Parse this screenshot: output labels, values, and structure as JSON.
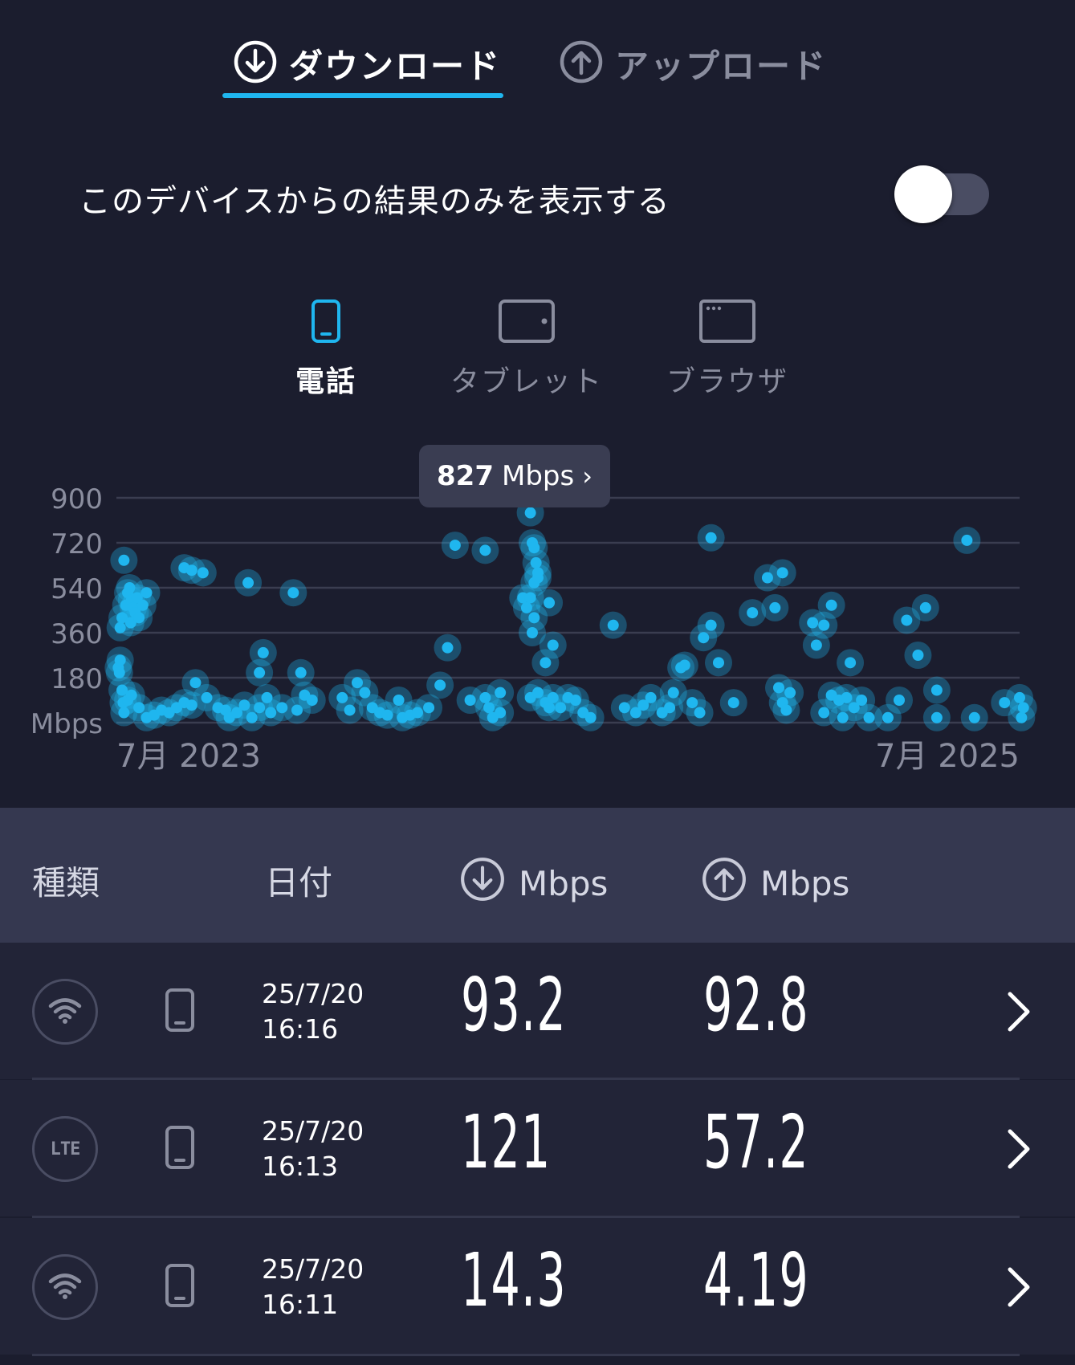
{
  "tabs": {
    "download_label": "ダウンロード",
    "upload_label": "アップロード"
  },
  "filter": {
    "toggle_label": "このデバイスからの結果のみを表示する",
    "toggle_on": false
  },
  "device_tabs": [
    {
      "label": "電話",
      "icon": "phone-icon",
      "active": true
    },
    {
      "label": "タブレット",
      "icon": "tablet-icon",
      "active": false
    },
    {
      "label": "ブラウザ",
      "icon": "browser-icon",
      "active": false
    }
  ],
  "tooltip": {
    "value": "827",
    "unit": "Mbps",
    "chevron": "›"
  },
  "chart_data": {
    "type": "scatter",
    "ylabel": "Mbps",
    "yticks": [
      "900",
      "720",
      "540",
      "360",
      "180"
    ],
    "ylim": [
      0,
      900
    ],
    "xlim": [
      0,
      24
    ],
    "xtick_labels": [
      "7月 2023",
      "7月 2025"
    ],
    "xtick_values": [
      0,
      24
    ],
    "marker_color": "#1fb6ef",
    "grid": true,
    "points": [
      [
        0.05,
        220
      ],
      [
        0.08,
        200
      ],
      [
        0.1,
        250
      ],
      [
        0.15,
        130
      ],
      [
        0.18,
        80
      ],
      [
        0.2,
        40
      ],
      [
        0.1,
        380
      ],
      [
        0.15,
        420
      ],
      [
        0.2,
        650
      ],
      [
        0.25,
        470
      ],
      [
        0.3,
        520
      ],
      [
        0.35,
        540
      ],
      [
        0.38,
        400
      ],
      [
        0.4,
        490
      ],
      [
        0.45,
        460
      ],
      [
        0.5,
        440
      ],
      [
        0.55,
        500
      ],
      [
        0.6,
        420
      ],
      [
        0.7,
        470
      ],
      [
        0.8,
        520
      ],
      [
        0.3,
        90
      ],
      [
        0.4,
        110
      ],
      [
        0.6,
        60
      ],
      [
        0.8,
        20
      ],
      [
        1.0,
        30
      ],
      [
        1.2,
        50
      ],
      [
        1.4,
        40
      ],
      [
        1.6,
        60
      ],
      [
        1.8,
        80
      ],
      [
        2.0,
        70
      ],
      [
        1.8,
        620
      ],
      [
        2.0,
        610
      ],
      [
        2.3,
        600
      ],
      [
        2.1,
        160
      ],
      [
        2.4,
        100
      ],
      [
        2.7,
        60
      ],
      [
        2.9,
        50
      ],
      [
        3.0,
        20
      ],
      [
        3.2,
        40
      ],
      [
        3.4,
        70
      ],
      [
        3.6,
        20
      ],
      [
        3.8,
        60
      ],
      [
        3.5,
        560
      ],
      [
        3.9,
        280
      ],
      [
        3.8,
        200
      ],
      [
        4.0,
        100
      ],
      [
        4.1,
        40
      ],
      [
        4.4,
        60
      ],
      [
        4.8,
        50
      ],
      [
        4.7,
        520
      ],
      [
        4.9,
        200
      ],
      [
        5.0,
        110
      ],
      [
        5.2,
        90
      ],
      [
        6.0,
        100
      ],
      [
        6.2,
        50
      ],
      [
        6.4,
        160
      ],
      [
        6.6,
        120
      ],
      [
        6.8,
        60
      ],
      [
        7.0,
        40
      ],
      [
        7.2,
        30
      ],
      [
        7.5,
        90
      ],
      [
        7.6,
        20
      ],
      [
        7.8,
        30
      ],
      [
        8.0,
        40
      ],
      [
        8.3,
        60
      ],
      [
        8.6,
        150
      ],
      [
        8.8,
        300
      ],
      [
        9.0,
        710
      ],
      [
        9.4,
        90
      ],
      [
        9.8,
        100
      ],
      [
        9.9,
        60
      ],
      [
        10.0,
        20
      ],
      [
        10.2,
        120
      ],
      [
        10.2,
        40
      ],
      [
        9.8,
        690
      ],
      [
        10.8,
        500
      ],
      [
        10.9,
        460
      ],
      [
        11.0,
        840
      ],
      [
        11.05,
        720
      ],
      [
        11.1,
        700
      ],
      [
        11.15,
        640
      ],
      [
        11.2,
        600
      ],
      [
        11.1,
        560
      ],
      [
        11.0,
        500
      ],
      [
        11.1,
        420
      ],
      [
        11.05,
        360
      ],
      [
        11.2,
        580
      ],
      [
        11.5,
        480
      ],
      [
        11.6,
        310
      ],
      [
        11.4,
        240
      ],
      [
        11.0,
        100
      ],
      [
        11.2,
        120
      ],
      [
        11.4,
        80
      ],
      [
        11.5,
        60
      ],
      [
        11.6,
        100
      ],
      [
        11.8,
        60
      ],
      [
        12.0,
        100
      ],
      [
        12.2,
        90
      ],
      [
        12.4,
        40
      ],
      [
        12.6,
        20
      ],
      [
        13.2,
        390
      ],
      [
        13.5,
        60
      ],
      [
        13.8,
        40
      ],
      [
        14.0,
        70
      ],
      [
        14.2,
        100
      ],
      [
        14.5,
        40
      ],
      [
        14.7,
        60
      ],
      [
        14.8,
        120
      ],
      [
        15.0,
        220
      ],
      [
        15.1,
        230
      ],
      [
        15.3,
        80
      ],
      [
        15.5,
        40
      ],
      [
        15.6,
        340
      ],
      [
        15.8,
        390
      ],
      [
        15.8,
        740
      ],
      [
        16.0,
        240
      ],
      [
        16.4,
        80
      ],
      [
        16.9,
        440
      ],
      [
        17.3,
        580
      ],
      [
        17.5,
        460
      ],
      [
        17.7,
        600
      ],
      [
        17.6,
        140
      ],
      [
        17.7,
        80
      ],
      [
        17.8,
        50
      ],
      [
        17.9,
        120
      ],
      [
        18.5,
        400
      ],
      [
        18.6,
        310
      ],
      [
        18.8,
        390
      ],
      [
        19.0,
        470
      ],
      [
        18.8,
        40
      ],
      [
        19.0,
        110
      ],
      [
        19.2,
        90
      ],
      [
        19.3,
        20
      ],
      [
        19.4,
        100
      ],
      [
        19.5,
        240
      ],
      [
        19.6,
        60
      ],
      [
        19.8,
        90
      ],
      [
        20.0,
        20
      ],
      [
        20.5,
        20
      ],
      [
        20.8,
        90
      ],
      [
        21.0,
        410
      ],
      [
        21.3,
        270
      ],
      [
        21.5,
        460
      ],
      [
        21.8,
        130
      ],
      [
        21.8,
        20
      ],
      [
        22.6,
        730
      ],
      [
        22.8,
        20
      ],
      [
        23.6,
        80
      ],
      [
        24.0,
        100
      ],
      [
        24.05,
        20
      ],
      [
        24.1,
        60
      ]
    ]
  },
  "table": {
    "col_type": "種類",
    "col_date": "日付",
    "col_down_unit": "Mbps",
    "col_up_unit": "Mbps",
    "rows": [
      {
        "type_icon": "wifi-icon",
        "type_text": "",
        "device_icon": "phone-icon",
        "date": "25/7/20",
        "time": "16:16",
        "download": "93.2",
        "upload": "92.8"
      },
      {
        "type_icon": "lte-icon",
        "type_text": "LTE",
        "device_icon": "phone-icon",
        "date": "25/7/20",
        "time": "16:13",
        "download": "121",
        "upload": "57.2"
      },
      {
        "type_icon": "wifi-icon",
        "type_text": "",
        "device_icon": "phone-icon",
        "date": "25/7/20",
        "time": "16:11",
        "download": "14.3",
        "upload": "4.19"
      }
    ]
  }
}
